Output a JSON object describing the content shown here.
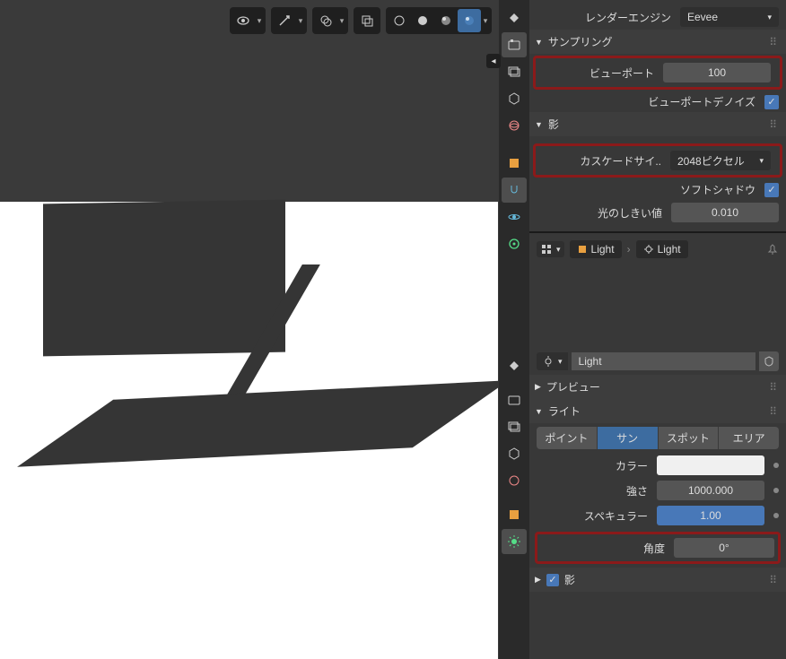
{
  "render": {
    "engine_label": "レンダーエンジン",
    "engine_value": "Eevee",
    "sampling_header": "サンプリング",
    "viewport_label": "ビューポート",
    "viewport_value": "100",
    "viewport_denoise_label": "ビューポートデノイズ",
    "shadow_header": "影",
    "cascade_label": "カスケードサイ..",
    "cascade_value": "2048ピクセル",
    "soft_shadow_label": "ソフトシャドウ",
    "light_threshold_label": "光のしきい値",
    "light_threshold_value": "0.010"
  },
  "light": {
    "breadcrumb_1": "Light",
    "breadcrumb_2": "Light",
    "data_name": "Light",
    "preview_header": "プレビュー",
    "light_header": "ライト",
    "types": {
      "point": "ポイント",
      "sun": "サン",
      "spot": "スポット",
      "area": "エリア"
    },
    "color_label": "カラー",
    "power_label": "強さ",
    "power_value": "1000.000",
    "specular_label": "スペキュラー",
    "specular_value": "1.00",
    "angle_label": "角度",
    "angle_value": "0°",
    "shadow_label": "影"
  }
}
